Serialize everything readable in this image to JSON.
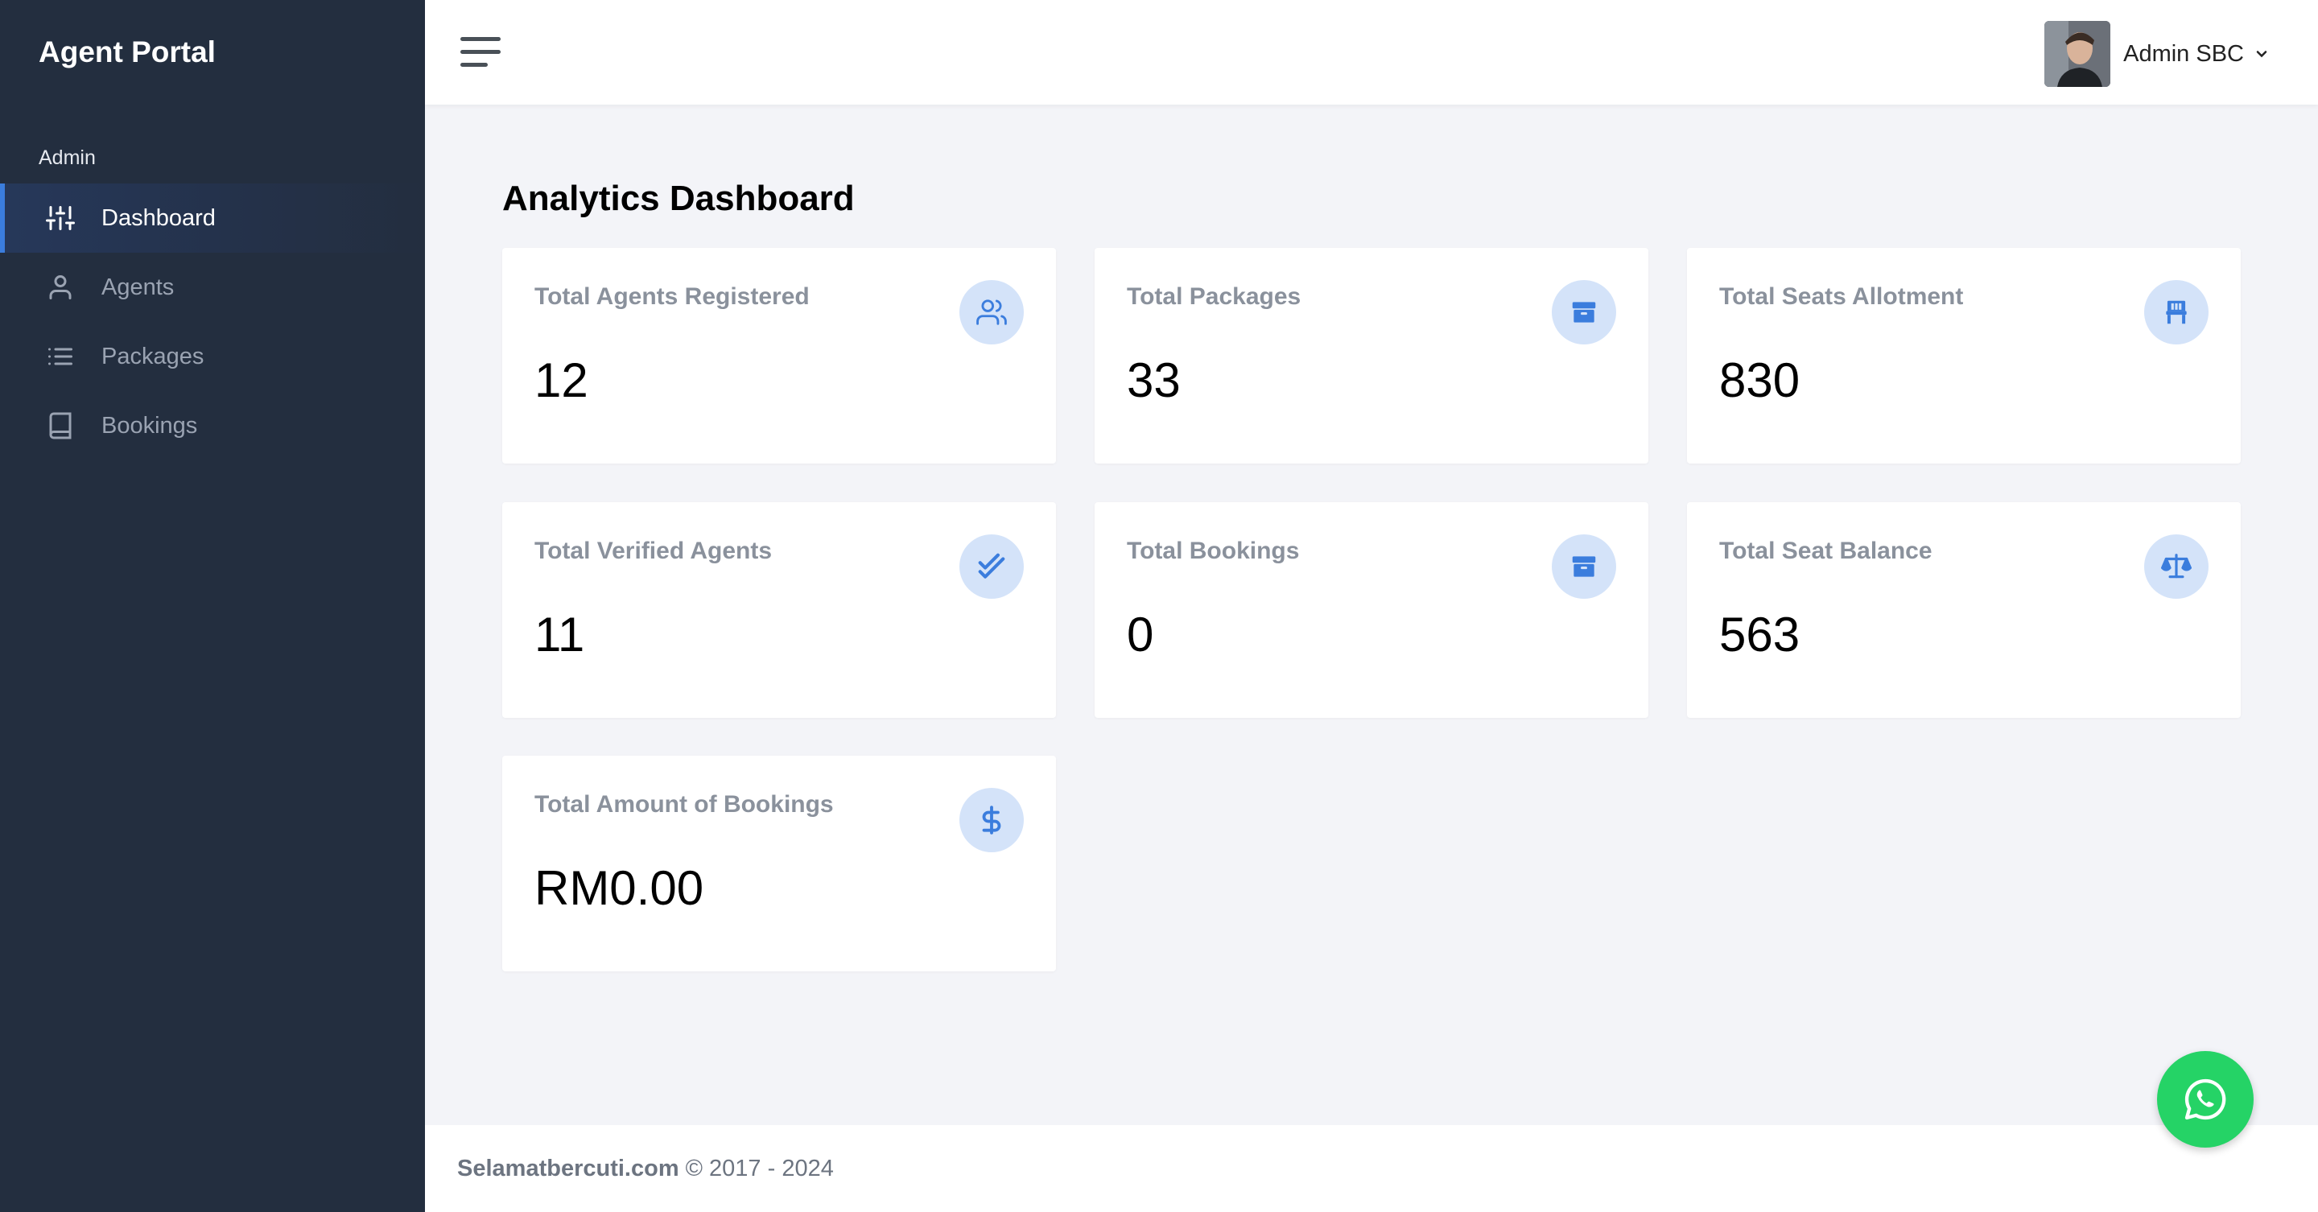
{
  "sidebar": {
    "brand": "Agent Portal",
    "section": "Admin",
    "items": [
      {
        "label": "Dashboard",
        "icon": "sliders-icon",
        "active": true
      },
      {
        "label": "Agents",
        "icon": "user-icon",
        "active": false
      },
      {
        "label": "Packages",
        "icon": "list-icon",
        "active": false
      },
      {
        "label": "Bookings",
        "icon": "book-icon",
        "active": false
      }
    ]
  },
  "topbar": {
    "user_name": "Admin SBC"
  },
  "main": {
    "title_bold": "Analytics",
    "title_rest": " Dashboard",
    "cards": [
      {
        "label": "Total Agents Registered",
        "value": "12",
        "icon": "users-icon"
      },
      {
        "label": "Total Packages",
        "value": "33",
        "icon": "package-icon"
      },
      {
        "label": "Total Seats Allotment",
        "value": "830",
        "icon": "seat-icon"
      },
      {
        "label": "Total Verified Agents",
        "value": "11",
        "icon": "double-check-icon"
      },
      {
        "label": "Total Bookings",
        "value": "0",
        "icon": "package-icon"
      },
      {
        "label": "Total Seat Balance",
        "value": "563",
        "icon": "scale-icon"
      },
      {
        "label": "Total Amount of Bookings",
        "value": "RM0.00",
        "icon": "dollar-icon"
      }
    ]
  },
  "footer": {
    "brand": "Selamatbercuti.com",
    "copyright": "© 2017 - 2024"
  },
  "colors": {
    "sidebar_bg": "#232e3f",
    "accent": "#3b7ddd",
    "icon_circle": "#d4e3f9",
    "whatsapp": "#25d366"
  }
}
